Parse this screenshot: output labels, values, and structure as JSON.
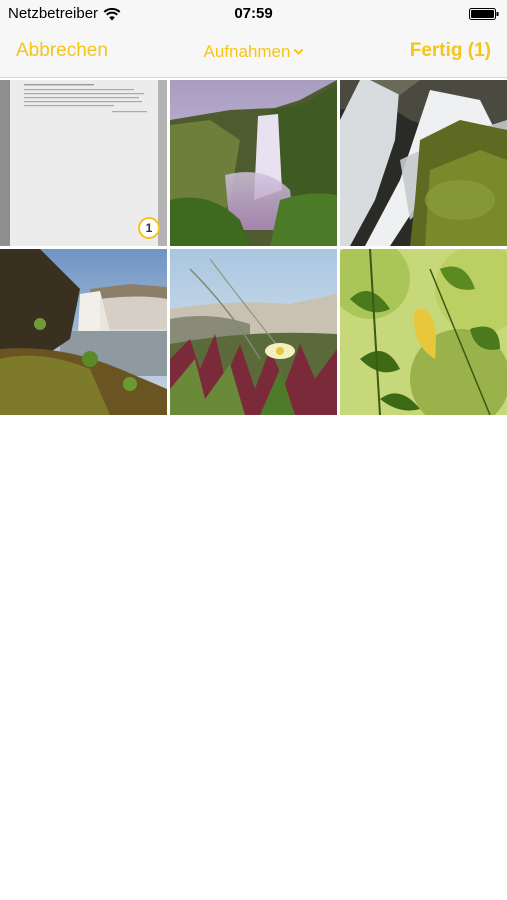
{
  "status_bar": {
    "carrier": "Netzbetreiber",
    "time": "07:59"
  },
  "nav": {
    "cancel_label": "Abbrechen",
    "title": "Aufnahmen",
    "done_label": "Fertig (1)"
  },
  "colors": {
    "accent": "#f5c518",
    "bar_background": "#f7f7f7"
  },
  "photos": [
    {
      "subject": "document",
      "selected": true,
      "selection_number": "1"
    },
    {
      "subject": "waterfall",
      "selected": false
    },
    {
      "subject": "waterfall-closeup",
      "selected": false
    },
    {
      "subject": "waterfall-coast",
      "selected": false
    },
    {
      "subject": "flower-dunes",
      "selected": false
    },
    {
      "subject": "leaves",
      "selected": false
    }
  ]
}
